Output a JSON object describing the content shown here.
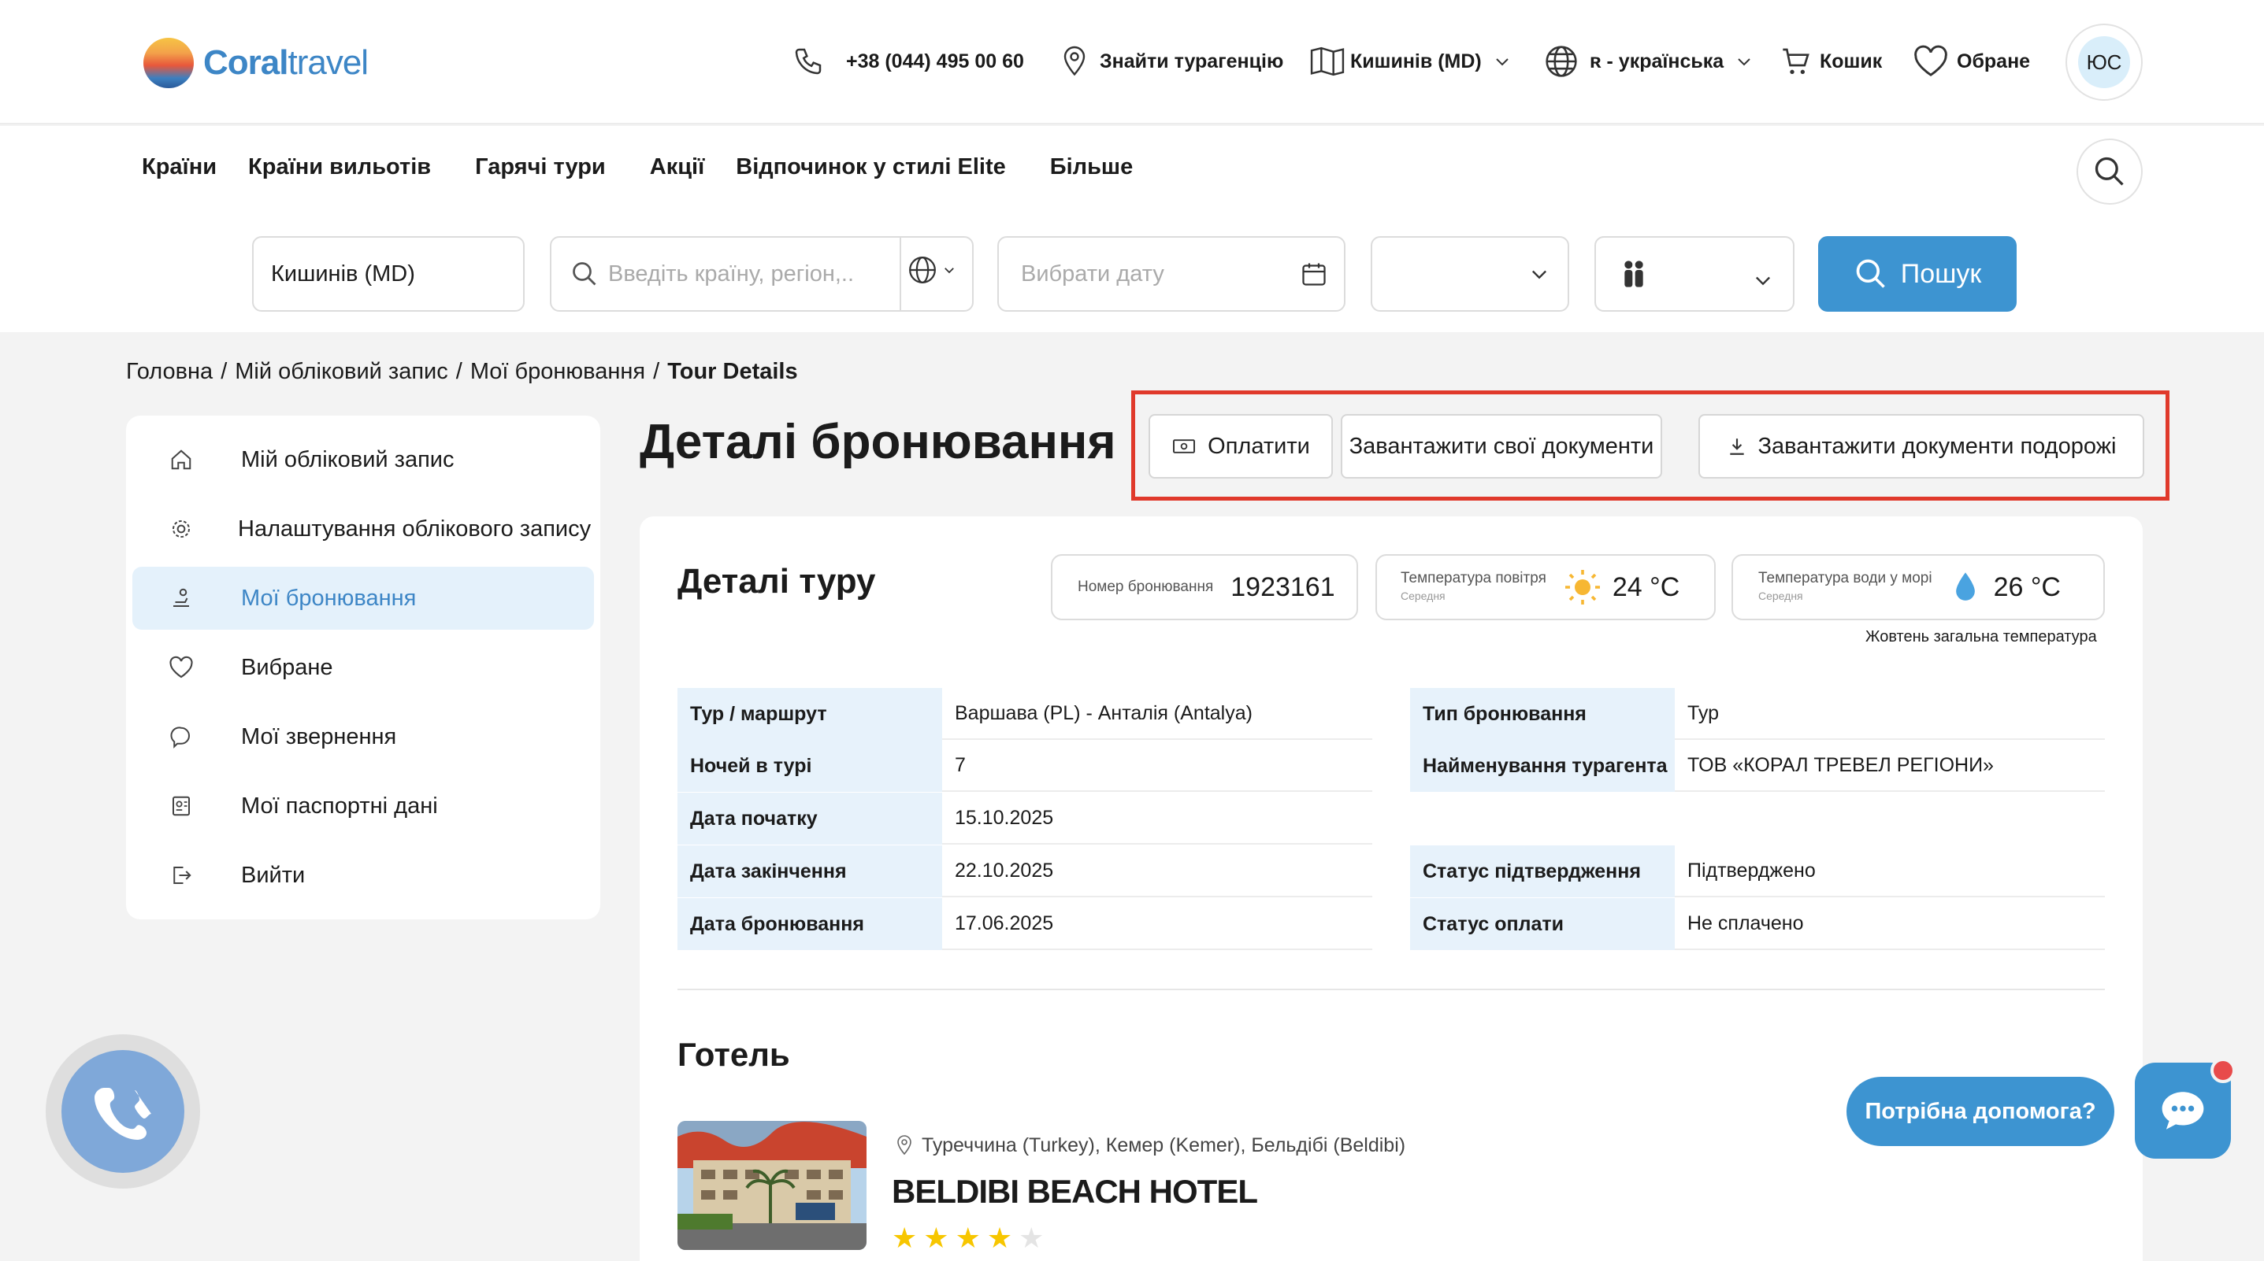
{
  "header": {
    "logo_text_bold": "Coral",
    "logo_text_light": "travel",
    "phone": "+38 (044) 495 00 60",
    "find_agency": "Знайти турагенцію",
    "city": "Кишинів (MD)",
    "language": "ʀ - українська",
    "cart": "Кошик",
    "favorites": "Обране",
    "avatar_initials": "ЮС"
  },
  "menu": [
    "Країни",
    "Країни вильотів",
    "Гарячі тури",
    "Акції",
    "Відпочинок у стилі Elite",
    "Більше"
  ],
  "search": {
    "departure_value": "Кишинів (MD)",
    "destination_placeholder": "Введіть країну, регіон,...",
    "date_placeholder": "Вибрати дату",
    "nights_value": "",
    "tourists_value": "",
    "button": "Пошук"
  },
  "breadcrumb": [
    "Головна",
    "Мій обліковий запис",
    "Мої бронювання",
    "Tour Details"
  ],
  "breadcrumb_sep": "/",
  "sidebar": {
    "items": [
      {
        "label": "Мій обліковий запис",
        "icon": "home-icon"
      },
      {
        "label": "Налаштування облікового запису",
        "icon": "gear-icon"
      },
      {
        "label": "Мої бронювання",
        "icon": "booking-icon",
        "active": true
      },
      {
        "label": "Вибране",
        "icon": "heart-icon"
      },
      {
        "label": "Мої звернення",
        "icon": "chat-icon"
      },
      {
        "label": "Мої паспортні дані",
        "icon": "passport-icon"
      },
      {
        "label": "Вийти",
        "icon": "logout-icon"
      }
    ]
  },
  "main": {
    "title": "Деталі бронювання",
    "actions": {
      "pay": "Оплатити",
      "upload": "Завантажити свої документи",
      "download": "Завантажити документи подорожі"
    },
    "card_title": "Деталі туру",
    "booking_number_label": "Номер бронювання",
    "booking_number": "1923161",
    "air_temp_label": "Температура повітря",
    "air_temp_sub": "Середня",
    "air_temp": "24 °C",
    "water_temp_label": "Температура води у морі",
    "water_temp_sub": "Середня",
    "water_temp": "26 °C",
    "temp_note": "Жовтень загальна температура",
    "details_left": [
      {
        "k": "Тур / маршрут",
        "v": "Варшава (PL) - Анталія (Antalya)"
      },
      {
        "k": "Ночей в турі",
        "v": "7"
      },
      {
        "k": "Дата початку",
        "v": "15.10.2025"
      },
      {
        "k": "Дата закінчення",
        "v": "22.10.2025"
      },
      {
        "k": "Дата бронювання",
        "v": "17.06.2025"
      }
    ],
    "details_right": [
      {
        "k": "Тип бронювання",
        "v": "Тур"
      },
      {
        "k": "Найменування турагента",
        "v": "ТОВ «КОРАЛ ТРЕВЕЛ РЕГІОНИ»"
      },
      {
        "k": "Статус підтвердження",
        "v": "Підтверджено"
      },
      {
        "k": "Статус оплати",
        "v": "Не сплачено"
      }
    ],
    "hotel_section": "Готель",
    "hotel_location": "Туреччина (Turkey), Кемер (Kemer), Бельдібі (Beldibi)",
    "hotel_name": "BELDIBI BEACH HOTEL",
    "hotel_stars": 4,
    "hotel_stars_max": 5
  },
  "help": {
    "bubble": "Потрібна допомога?"
  },
  "colors": {
    "accent": "#3d94d1",
    "highlight": "#e0392b",
    "row_key_bg": "#e7f2fb",
    "star": "#f7c600"
  }
}
